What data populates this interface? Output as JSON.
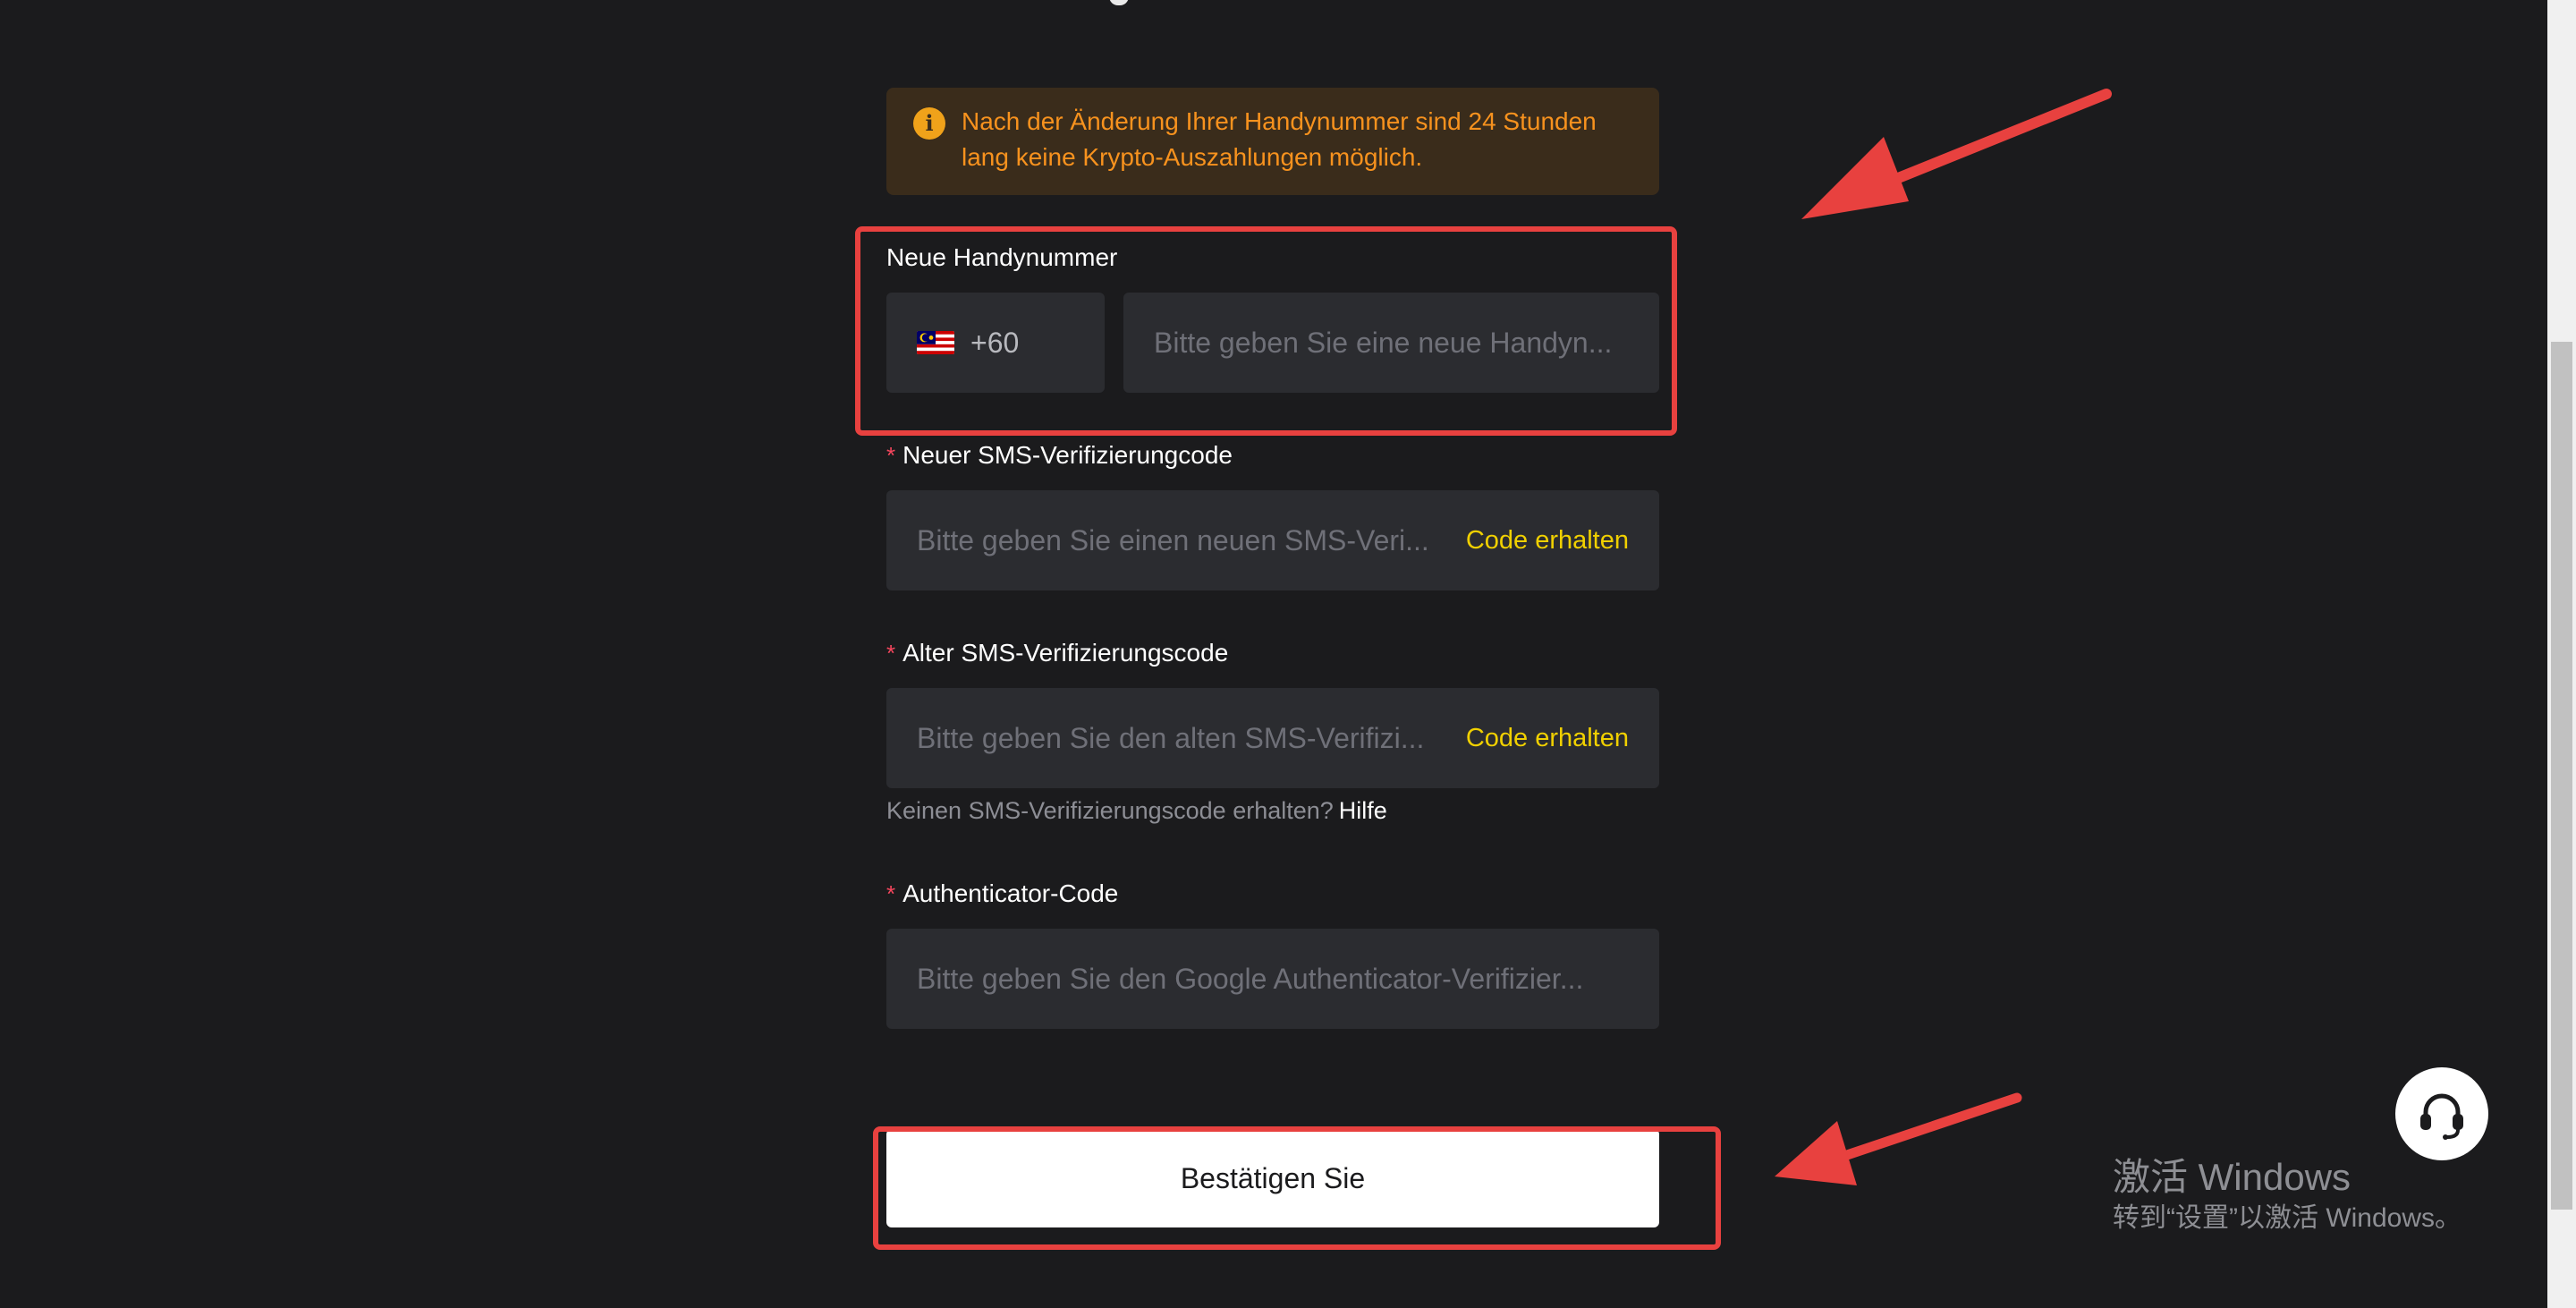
{
  "notice": {
    "line1": "Nach der Änderung Ihrer Handynummer sind 24 Stunden",
    "line2": "lang keine Krypto-Auszahlungen möglich.",
    "icon": "info-icon",
    "color": "#f7921e"
  },
  "phone": {
    "label": "Neue Handynummer",
    "country_flag": "malaysia-flag-icon",
    "dial_code": "+60",
    "placeholder": "Bitte geben Sie eine neue Handyn..."
  },
  "new_sms": {
    "required_mark": "*",
    "label": "Neuer SMS-Verifizierungcode",
    "placeholder": "Bitte geben Sie einen neuen SMS-Veri...",
    "action": "Code erhalten"
  },
  "old_sms": {
    "required_mark": "*",
    "label": "Alter SMS-Verifizierungscode",
    "placeholder": "Bitte geben Sie den alten SMS-Verifizi...",
    "action": "Code erhalten"
  },
  "help": {
    "text": "Keinen SMS-Verifizierungscode erhalten?",
    "link": "Hilfe"
  },
  "authenticator": {
    "required_mark": "*",
    "label": "Authenticator-Code",
    "placeholder": "Bitte geben Sie den Google Authenticator-Verifizier..."
  },
  "confirm_button": "Bestätigen Sie",
  "support_icon": "headset-icon",
  "watermark": {
    "line1": "激活 Windows",
    "line2": "转到“设置”以激活 Windows。"
  },
  "colors": {
    "background": "#1b1b1d",
    "accent_link": "#f0d000",
    "annotation_red": "#e8413f"
  }
}
